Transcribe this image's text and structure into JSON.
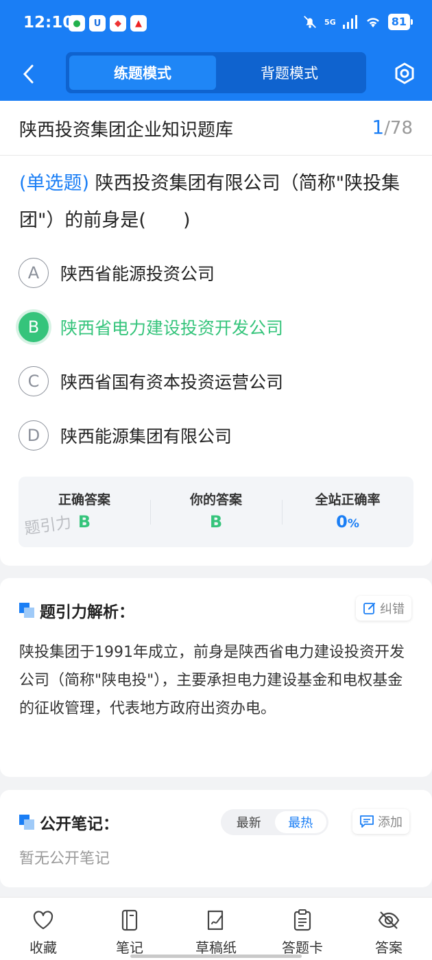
{
  "status_bar": {
    "time": "12:10",
    "signal": "5G",
    "battery": "81",
    "app_icons": [
      "wechat-icon",
      "u-app-icon",
      "game-app-icon",
      "a-app-icon"
    ]
  },
  "header": {
    "modes": [
      {
        "label": "练题模式",
        "active": true
      },
      {
        "label": "背题模式",
        "active": false
      }
    ]
  },
  "question_bank": {
    "title": "陕西投资集团企业知识题库",
    "current": "1",
    "total": "/78"
  },
  "question": {
    "type": "(单选题)",
    "text": "陕西投资集团有限公司（简称\"陕投集团\"）的前身是(　　)",
    "options": [
      {
        "letter": "A",
        "text": "陕西省能源投资公司",
        "selected": false
      },
      {
        "letter": "B",
        "text": "陕西省电力建设投资开发公司",
        "selected": true
      },
      {
        "letter": "C",
        "text": "陕西省国有资本投资运营公司",
        "selected": false
      },
      {
        "letter": "D",
        "text": "陕西能源集团有限公司",
        "selected": false
      }
    ]
  },
  "answer_summary": {
    "correct_label": "正确答案",
    "correct_value": "B",
    "your_label": "你的答案",
    "your_value": "B",
    "rate_label": "全站正确率",
    "rate_value": "0",
    "rate_unit": "%",
    "watermark": "题引力"
  },
  "analysis": {
    "title": "题引力解析：",
    "correct_button": "纠错",
    "text": "陕投集团于1991年成立，前身是陕西省电力建设投资开发公司（简称\"陕电投\"），主要承担电力建设基金和电权基金的征收管理，代表地方政府出资办电。"
  },
  "notes": {
    "title": "公开笔记：",
    "sort_options": [
      {
        "label": "最新",
        "active": false
      },
      {
        "label": "最热",
        "active": true
      }
    ],
    "add_button": "添加",
    "empty_text": "暂无公开笔记"
  },
  "bottom_bar": [
    {
      "label": "收藏",
      "icon": "heart-icon"
    },
    {
      "label": "笔记",
      "icon": "notebook-icon"
    },
    {
      "label": "草稿纸",
      "icon": "draft-paper-icon"
    },
    {
      "label": "答题卡",
      "icon": "answer-sheet-icon"
    },
    {
      "label": "答案",
      "icon": "eye-off-icon"
    }
  ],
  "colors": {
    "brand_blue": "#1a7ef5",
    "correct_green": "#35c47b"
  }
}
